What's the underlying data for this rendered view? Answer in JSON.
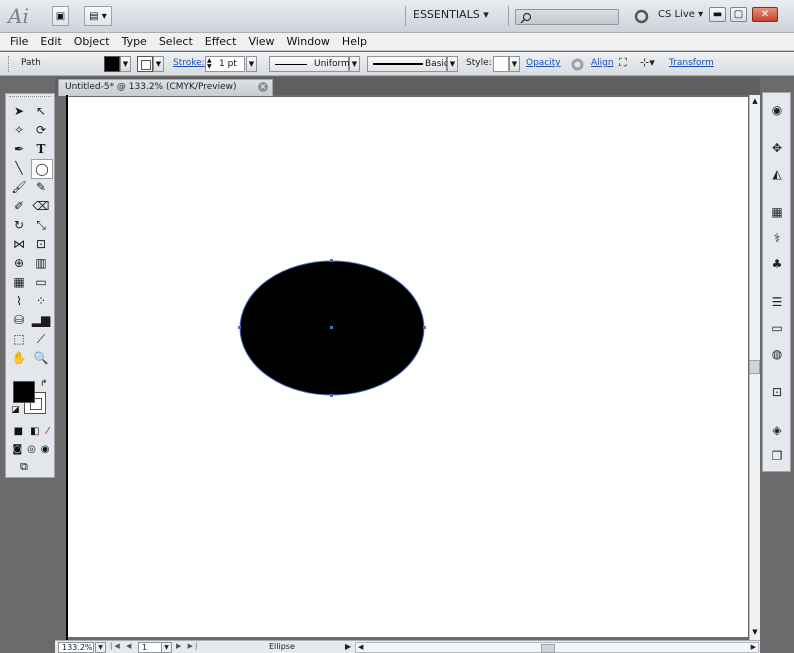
{
  "app": {
    "logo": "Ai",
    "workspace": "ESSENTIALS",
    "cslive": "CS Live"
  },
  "menu": [
    "File",
    "Edit",
    "Object",
    "Type",
    "Select",
    "Effect",
    "View",
    "Window",
    "Help"
  ],
  "control": {
    "selection": "Path",
    "stroke_label": "Stroke:",
    "stroke_value": "1 pt",
    "profile": "Uniform",
    "brush": "Basic",
    "style_label": "Style:",
    "opacity_label": "Opacity",
    "align_label": "Align",
    "transform_label": "Transform"
  },
  "document": {
    "tab_title": "Untitled-5* @ 133.2% (CMYK/Preview)",
    "tab_close": "×"
  },
  "status": {
    "zoom": "133.2%",
    "artboard": "1",
    "object": "Ellipse"
  },
  "colors": {
    "fill": "#000000",
    "stroke": "#ffffff",
    "selection": "#4a6fc0"
  }
}
